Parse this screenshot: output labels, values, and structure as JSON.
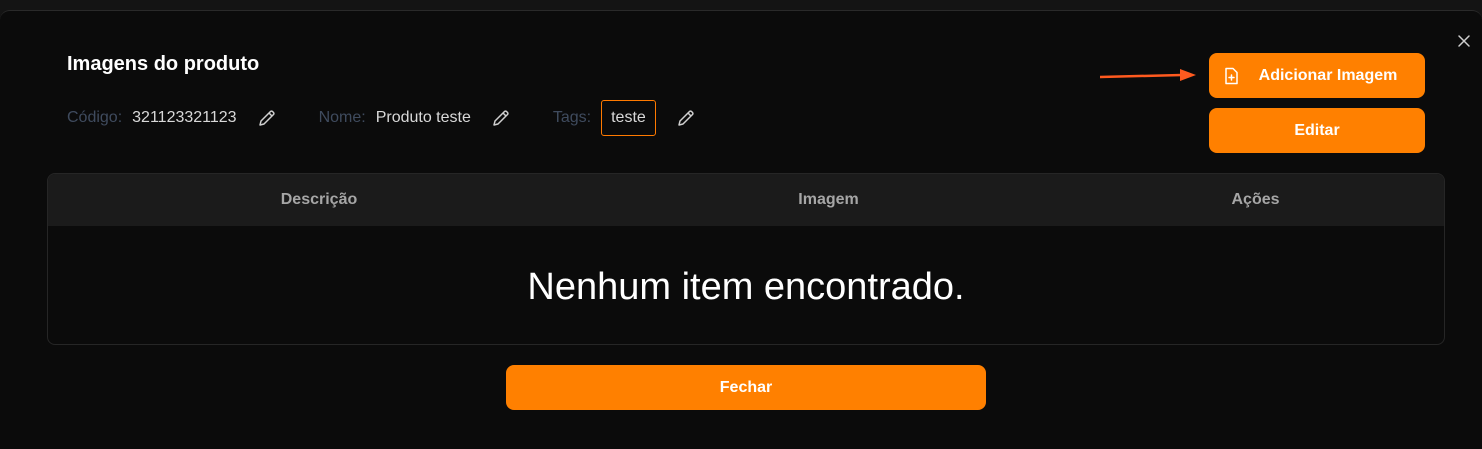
{
  "modal": {
    "title": "Imagens do produto",
    "close_icon": "close-icon"
  },
  "product": {
    "code_label": "Código:",
    "code_value": "321123321123",
    "name_label": "Nome:",
    "name_value": "Produto teste",
    "tags_label": "Tags:",
    "tags": [
      "teste"
    ]
  },
  "actions": {
    "add_image_label": "Adicionar Imagem",
    "edit_label": "Editar",
    "close_label": "Fechar"
  },
  "table": {
    "columns": [
      "Descrição",
      "Imagem",
      "Ações"
    ],
    "empty_message": "Nenhum item encontrado."
  },
  "colors": {
    "accent": "#ff8000",
    "background": "#0b0b0b",
    "header_bg": "#1b1b1b",
    "label_muted": "#3f4b5e"
  }
}
